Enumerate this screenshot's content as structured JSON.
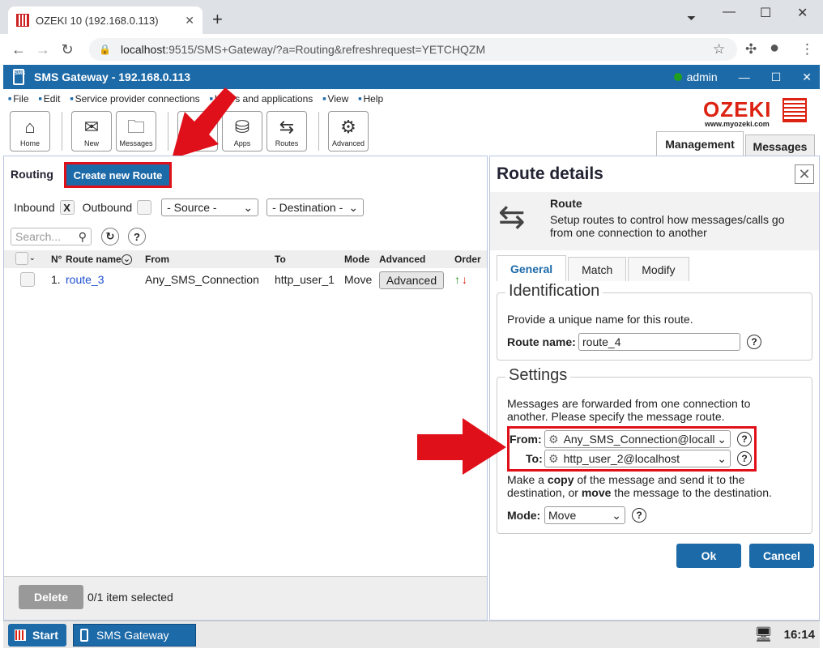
{
  "browser": {
    "tab_title": "OZEKI 10 (192.168.0.113)",
    "url_host": "localhost",
    "url_rest": ":9515/SMS+Gateway/?a=Routing&refreshrequest=YETCHQZM"
  },
  "app": {
    "title": "SMS Gateway - 192.168.0.113",
    "user": "admin",
    "menu": [
      "File",
      "Edit",
      "Service provider connections",
      "Users and applications",
      "View",
      "Help"
    ],
    "toolbar": [
      "Home",
      "New",
      "Messages",
      "Apps",
      "Routes",
      "Advanced"
    ],
    "logo_text": "OZEKI",
    "logo_url": "www.myozeki.com",
    "main_tabs": [
      "Management",
      "Messages"
    ]
  },
  "routing": {
    "heading": "Routing",
    "create_button": "Create new Route",
    "inbound_label": "Inbound",
    "inbound_mark": "X",
    "outbound_label": "Outbound",
    "source_select": "- Source -",
    "destination_select": "- Destination -",
    "search_placeholder": "Search...",
    "columns": [
      "N°",
      "Route name",
      "From",
      "To",
      "Mode",
      "Advanced",
      "Order"
    ],
    "rows": [
      {
        "n": "1.",
        "name": "route_3",
        "from": "Any_SMS_Connection",
        "to": "http_user_1",
        "mode": "Move",
        "advanced": "Advanced"
      }
    ],
    "delete_button": "Delete",
    "selection_status": "0/1 item selected"
  },
  "details": {
    "title": "Route details",
    "header_title": "Route",
    "header_desc": "Setup routes to control how messages/calls go from one connection to another",
    "tabs": [
      "General",
      "Match",
      "Modify"
    ],
    "identification": {
      "legend": "Identification",
      "desc": "Provide a unique name for this route.",
      "name_label": "Route name:",
      "name_value": "route_4"
    },
    "settings": {
      "legend": "Settings",
      "desc": "Messages are forwarded from one connection to another. Please specify the message route.",
      "from_label": "From:",
      "from_value": "Any_SMS_Connection@locall",
      "to_label": "To:",
      "to_value": "http_user_2@localhost",
      "copy_desc_1": "Make a ",
      "copy_word": "copy",
      "copy_desc_2": " of the message and send it to the destination, or ",
      "move_word": "move",
      "copy_desc_3": " the message to the destination.",
      "mode_label": "Mode:",
      "mode_value": "Move"
    },
    "ok_button": "Ok",
    "cancel_button": "Cancel"
  },
  "taskbar": {
    "start": "Start",
    "app": "SMS Gateway",
    "clock": "16:14"
  }
}
